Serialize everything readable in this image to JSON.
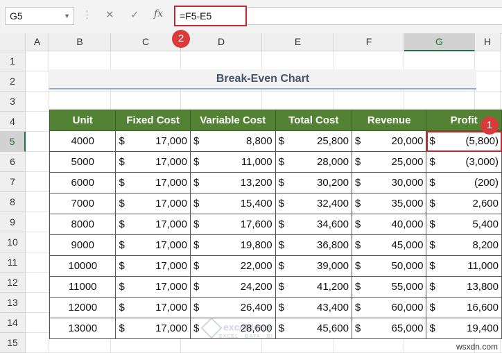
{
  "formula_bar": {
    "name_box": "G5",
    "cancel_icon": "✕",
    "enter_icon": "✓",
    "fx_icon": "fx",
    "formula": "=F5-E5"
  },
  "markers": {
    "one": "1",
    "two": "2"
  },
  "columns": [
    "A",
    "B",
    "C",
    "D",
    "E",
    "F",
    "G",
    "H"
  ],
  "rows": [
    "1",
    "2",
    "3",
    "4",
    "5",
    "6",
    "7",
    "8",
    "9",
    "10",
    "11",
    "12",
    "13",
    "14",
    "15"
  ],
  "selected_cell": {
    "column": "G",
    "row": "5"
  },
  "sheet": {
    "title": "Break-Even Chart",
    "headers": [
      "Unit",
      "Fixed Cost",
      "Variable Cost",
      "Total Cost",
      "Revenue",
      "Profit"
    ],
    "currency_symbol": "$",
    "rows": [
      [
        "4000",
        "17,000",
        "8,800",
        "25,800",
        "20,000",
        "(5,800)"
      ],
      [
        "5000",
        "17,000",
        "11,000",
        "28,000",
        "25,000",
        "(3,000)"
      ],
      [
        "6000",
        "17,000",
        "13,200",
        "30,200",
        "30,000",
        "(200)"
      ],
      [
        "7000",
        "17,000",
        "15,400",
        "32,400",
        "35,000",
        "2,600"
      ],
      [
        "8000",
        "17,000",
        "17,600",
        "34,600",
        "40,000",
        "5,400"
      ],
      [
        "9000",
        "17,000",
        "19,800",
        "36,800",
        "45,000",
        "8,200"
      ],
      [
        "10000",
        "17,000",
        "22,000",
        "39,000",
        "50,000",
        "11,000"
      ],
      [
        "11000",
        "17,000",
        "24,200",
        "41,200",
        "55,000",
        "13,800"
      ],
      [
        "12000",
        "17,000",
        "26,400",
        "43,400",
        "60,000",
        "16,600"
      ],
      [
        "13000",
        "17,000",
        "28,600",
        "45,600",
        "65,000",
        "19,400"
      ]
    ]
  },
  "watermark": {
    "name": "exceldemy",
    "tagline": "EXCEL · DATA · BI"
  },
  "credit": "wsxdn.com"
}
